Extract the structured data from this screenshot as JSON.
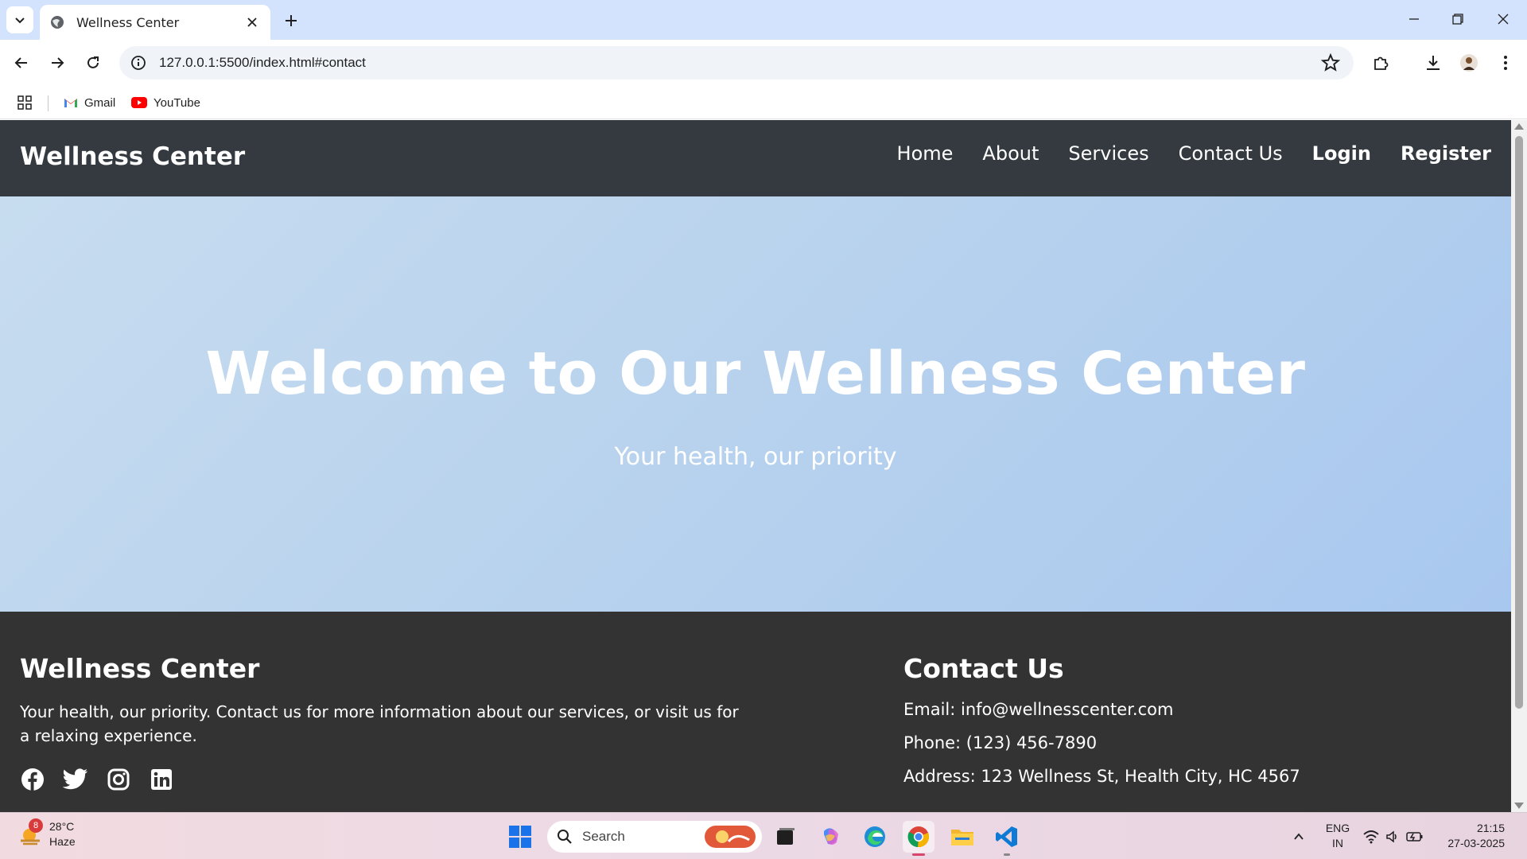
{
  "browser": {
    "tab_title": "Wellness Center",
    "url": "127.0.0.1:5500/index.html#contact",
    "bookmarks": [
      {
        "label": "Gmail",
        "icon": "gmail-icon"
      },
      {
        "label": "YouTube",
        "icon": "youtube-icon"
      }
    ]
  },
  "site": {
    "brand": "Wellness Center",
    "nav": [
      "Home",
      "About",
      "Services",
      "Contact Us",
      "Login",
      "Register"
    ],
    "hero": {
      "title": "Welcome to Our Wellness Center",
      "subtitle": "Your health, our priority"
    },
    "footer": {
      "about_title": "Wellness Center",
      "about_text": "Your health, our priority. Contact us for more information about our services, or visit us for a relaxing experience.",
      "social": [
        "facebook-icon",
        "twitter-icon",
        "instagram-icon",
        "linkedin-icon"
      ],
      "contact_title": "Contact Us",
      "email": "Email: info@wellnesscenter.com",
      "phone": "Phone: (123) 456-7890",
      "address": "Address: 123 Wellness St, Health City, HC 4567"
    },
    "colors": {
      "navbar": "#343a40",
      "footer": "#333333",
      "hero_gradient_start": "#c7dcef",
      "hero_gradient_end": "#a9c8ef"
    }
  },
  "taskbar": {
    "weather_badge": "8",
    "temperature": "28°C",
    "condition": "Haze",
    "search_placeholder": "Search",
    "lang_top": "ENG",
    "lang_bottom": "IN",
    "time": "21:15",
    "date": "27-03-2025"
  }
}
